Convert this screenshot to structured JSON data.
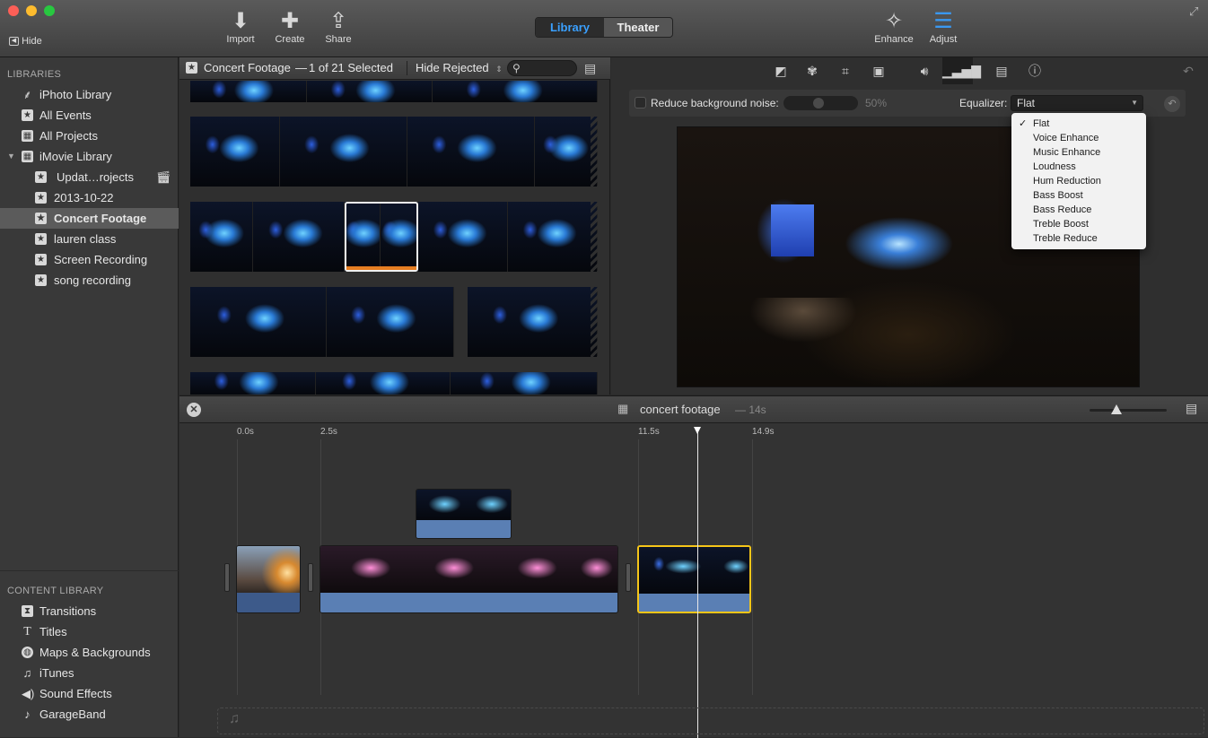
{
  "toolbar": {
    "hide_label": "Hide",
    "import_label": "Import",
    "create_label": "Create",
    "share_label": "Share",
    "tab_library": "Library",
    "tab_theater": "Theater",
    "enhance_label": "Enhance",
    "adjust_label": "Adjust"
  },
  "sidebar": {
    "libraries_header": "LIBRARIES",
    "items": [
      {
        "label": "iPhoto Library",
        "icon": "palm-icon"
      },
      {
        "label": "All Events",
        "icon": "star-icon"
      },
      {
        "label": "All Projects",
        "icon": "grid-icon"
      },
      {
        "label": "iMovie Library",
        "icon": "grid-icon"
      },
      {
        "label": "Updat…rojects",
        "icon": "star-icon"
      },
      {
        "label": "2013-10-22",
        "icon": "star-icon"
      },
      {
        "label": "Concert Footage",
        "icon": "star-icon"
      },
      {
        "label": "lauren class",
        "icon": "star-icon"
      },
      {
        "label": "Screen Recording",
        "icon": "star-icon"
      },
      {
        "label": "song recording",
        "icon": "star-icon"
      }
    ],
    "content_header": "CONTENT LIBRARY",
    "content_items": [
      {
        "label": "Transitions",
        "icon": "transitions-icon"
      },
      {
        "label": "Titles",
        "icon": "titles-icon"
      },
      {
        "label": "Maps & Backgrounds",
        "icon": "globe-icon"
      },
      {
        "label": "iTunes",
        "icon": "music-note-icon"
      },
      {
        "label": "Sound Effects",
        "icon": "speaker-icon"
      },
      {
        "label": "GarageBand",
        "icon": "guitar-icon"
      }
    ]
  },
  "browser": {
    "title": "Concert Footage",
    "dash": "—",
    "selection": "1 of 21 Selected",
    "filter": "Hide Rejected"
  },
  "viewer": {
    "noise_label": "Reduce background noise:",
    "noise_value": "50%",
    "equalizer_label": "Equalizer:",
    "equalizer_value": "Flat",
    "equalizer_options": [
      "Flat",
      "Voice Enhance",
      "Music Enhance",
      "Loudness",
      "Hum Reduction",
      "Bass Boost",
      "Bass Reduce",
      "Treble Boost",
      "Treble Reduce"
    ],
    "checked_option": "✓"
  },
  "timeline": {
    "project_name": "concert footage",
    "duration": "— 14s",
    "ticks": [
      "0.0s",
      "2.5s",
      "11.5s",
      "14.9s"
    ]
  }
}
